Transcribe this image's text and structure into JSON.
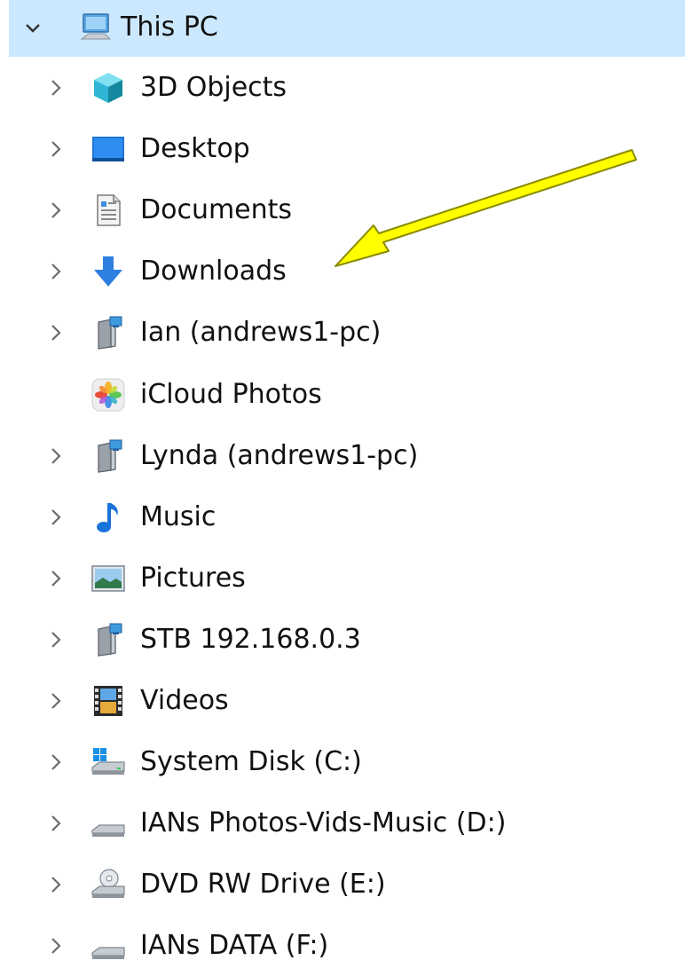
{
  "tree": {
    "root": {
      "label": "This PC",
      "icon": "computer-icon",
      "expanded": true
    },
    "items": [
      {
        "label": "3D Objects",
        "icon": "3d-objects-icon",
        "has_children": true
      },
      {
        "label": "Desktop",
        "icon": "desktop-icon",
        "has_children": true
      },
      {
        "label": "Documents",
        "icon": "documents-icon",
        "has_children": true
      },
      {
        "label": "Downloads",
        "icon": "downloads-icon",
        "has_children": true
      },
      {
        "label": "Ian (andrews1-pc)",
        "icon": "network-folder-icon",
        "has_children": true
      },
      {
        "label": "iCloud Photos",
        "icon": "icloud-photos-icon",
        "has_children": false
      },
      {
        "label": "Lynda (andrews1-pc)",
        "icon": "network-folder-icon",
        "has_children": true
      },
      {
        "label": "Music",
        "icon": "music-icon",
        "has_children": true
      },
      {
        "label": "Pictures",
        "icon": "pictures-icon",
        "has_children": true
      },
      {
        "label": "STB 192.168.0.3",
        "icon": "network-folder-icon",
        "has_children": true
      },
      {
        "label": "Videos",
        "icon": "videos-icon",
        "has_children": true
      },
      {
        "label": "System Disk (C:)",
        "icon": "system-drive-icon",
        "has_children": true
      },
      {
        "label": "IANs Photos-Vids-Music (D:)",
        "icon": "drive-icon",
        "has_children": true
      },
      {
        "label": "DVD RW Drive (E:)",
        "icon": "dvd-drive-icon",
        "has_children": true
      },
      {
        "label": "IANs DATA (F:)",
        "icon": "drive-icon",
        "has_children": true
      }
    ]
  },
  "annotation": {
    "icon": "yellow-arrow-icon",
    "points_to": "Downloads",
    "color": "#ffff00"
  },
  "colors": {
    "selection": "#cce8ff",
    "chevron": "#6b6b6b",
    "accent": "#1a73d9"
  }
}
